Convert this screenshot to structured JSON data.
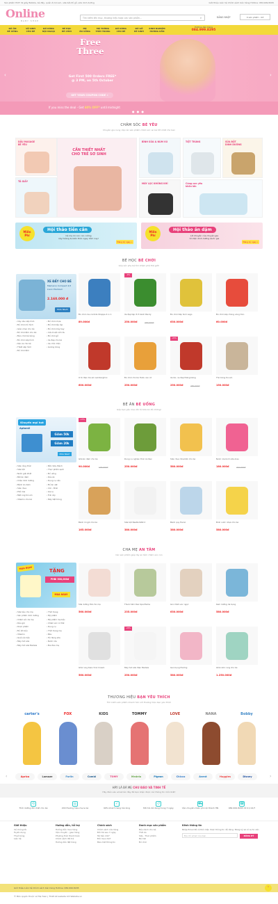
{
  "topbar": {
    "left": "Sản phẩm HOT: tã giấy Bobble, bé đẩy, quần ối,hơi em, sữa bột,đồ gỗ, sữa dinh dưỡng",
    "right": "Giới thiệu   Liên hệ   Chính sách bán hàng   Hotline: 084.999.8295"
  },
  "header": {
    "logo_main": "Online",
    "logo_sub": "BABY SHOP",
    "search_placeholder": "Tìm kiếm tên mục, thương hiệu hoặc các sản phẩm...",
    "account_link": "ĐĂNG NHẬP",
    "cart": "0 sản phẩm - 0đ"
  },
  "nav": {
    "items": [
      {
        "label": "ĐỒ ĂN\nBÉ UỐNG"
      },
      {
        "label": "VỆ SINH\nCHO BÉ"
      },
      {
        "label": "ĐỒ DÙNG\nNỘI NGOẠI"
      },
      {
        "label": "BÉ HỌC\nBÉ CHƠI"
      },
      {
        "label": "MẸ\nĂN UỐNG"
      },
      {
        "label": "MẸ TƯỜNG\nTHỜI TRANG"
      },
      {
        "label": "ĐỒ DÙNG\nCHO BÉ"
      },
      {
        "label": "ĐỒ GỖ\nBÉ SINH"
      },
      {
        "label": "KINH NGHIỆM\nHƯỚNG DẪN"
      }
    ],
    "hotline_label": "Hotline bán hàng",
    "hotline_number": "084.999.8295"
  },
  "banner": {
    "headline": "Free\nThree",
    "line1": "Get First 500 Orders FREE*",
    "line2": "@ 3 PM, on 5th October",
    "coupon_btn": "GET YOUR COUPON CODE »",
    "bottom_pre": "If you miss the deal - Get ",
    "bottom_highlight": "60% OFF*",
    "bottom_post": " until midnight",
    "prev": "‹",
    "next": "›",
    "dots": "● ● ●"
  },
  "sections": {
    "care": {
      "pre": "CHĂM SÓC ",
      "hl": "BÉ YÊU",
      "sub": "Chuyên gia cung cấp các sản phẩm chăm sóc an bé tốt nhất cho bạn"
    },
    "toys": {
      "pre": "BÉ HỌC ",
      "hl": "BÉ CHƠI",
      "sub": "Góp sức phụ bé tìm khám phá thế giới!"
    },
    "food": {
      "pre": "BÉ ĂN ",
      "hl": "BÉ UỐNG",
      "sub": "Góp bạn yêu mau lớn từ bữa ăn đó những!"
    },
    "mom": {
      "pre": "CHA MẸ ",
      "hl": "AN TÂM",
      "sub": "Các sản phẩm giúp lấy an tâm chăm sóc con"
    },
    "brands": {
      "pre": "THƯƠNG HIỆU ",
      "hl": "BẠN YÊU THÍCH",
      "sub": "Tìm kiếm sản phẩm nhanh hơn với thương hiệu bạn yêu thích"
    }
  },
  "care_tiles": [
    {
      "label": "DẦU MASAGE\nBÉ YÊU"
    },
    {
      "label": "CẦN THIẾT NHẤT\nCHO TRẺ SƠ SINH"
    },
    {
      "label": "BÌNH SỮA & NÚM VÚ"
    },
    {
      "label": "TIỆT TRÙNG"
    },
    {
      "label": "SỮA BỘT\nDINH DƯỠNG"
    },
    {
      "label": "TÃ GIẤY"
    },
    {
      "label": "MÁY LỌC KHÔNG KHÍ"
    },
    {
      "label": "Cùng con yêu\nkhôn lớn"
    }
  ],
  "wide_banners": [
    {
      "badge": "Miễn\nPhí",
      "title": "Hội thảo tiền cân",
      "desc": "Cả mẹ mi con con cường\nnày hoàng bị kiến thức ngay hôm nay!",
      "btn": "Đăng ký ngay »"
    },
    {
      "badge": "Miễn\nPhí",
      "title": "Hội thảo ăn dặm",
      "desc": "Lời khuyên của chuyên gia\ntừ Viện dinh dưỡng Quốc gia",
      "btn": "Đăng ký ngay »"
    }
  ],
  "toys_promo": {
    "title": "XE ĐẨY CHO BÉ",
    "sub": "Mamaroo Compact 2/3",
    "sub2": "Livon Premium",
    "price": "2.160.000 đ",
    "btn": "MUA NGAY"
  },
  "toys_links": [
    "Cây xâu xếp hình",
    "Đồ chơi mô hình",
    "Giàn nhạc cho bé",
    "Đồ chơi tắm cho bé",
    "Đèn chơi bé bóng",
    "Đồ chơi xếp hình",
    "Kéo xe cho bé",
    "Thiết xếp hình",
    "Đồ chơi tắm",
    "Đồ chơi nhựa",
    "Đồ chơi lắp ráp",
    "Đồ chơi máy bay",
    "Cầu trượt xích đu",
    "Đồ chơi gỗ",
    "Xe đạp cho bé",
    "Xe chòi chân",
    "Gương bóng"
  ],
  "toys_products": [
    {
      "name": "Đồ chơi câu cá Kids Shoppe 4 in 1",
      "price": "89.000đ",
      "old": "",
      "disc": ""
    },
    {
      "name": "Xe đạp tập đi 3 bánh Pandy",
      "price": "250.000đ",
      "old": "290.000đ",
      "disc": "-4%"
    },
    {
      "name": "Đồ chơi Xếp hình Lego",
      "price": "630.000đ",
      "old": "",
      "disc": ""
    },
    {
      "name": "Đồ chơi xếp chồng vòng tròn",
      "price": "60.000đ",
      "old": "",
      "disc": ""
    },
    {
      "name": "Ô tô điện trẻ em Lamborghini",
      "price": "600.000đ",
      "old": "",
      "disc": ""
    },
    {
      "name": "Đồ chơi cho bé Hươu cao cổ",
      "price": "250.000đ",
      "old": "",
      "disc": ""
    },
    {
      "name": "Xe lắc, xe đạp thăng bằng",
      "price": "250.000đ",
      "old": "280.000đ",
      "disc": "-21%"
    },
    {
      "name": "Thỏ bông trẻ em",
      "price": "150.000đ",
      "old": "",
      "disc": ""
    }
  ],
  "food_promo": {
    "title": "Khuyến mại hot",
    "brand": "Aptamil",
    "tag1": "Giảm 50k",
    "tag2": "Giảm 20k",
    "btn": "MUA NGAY"
  },
  "food_links": [
    "Sữa công thức",
    "Sữa bột",
    "Nước giải khát",
    "Bột ăn dặm",
    "Cháo dinh dưỡng",
    "Bánh ăn dặm",
    "Sữa chua",
    "Phô mai",
    "Mật ong trẻ em",
    "Vitamin cho bé",
    "Bột, Sữa, Bánh",
    "Thực phẩm sạch",
    "Đồ uống",
    "Dầu ăn",
    "Dụng cụ nấu",
    "Đồ ăn vặt",
    "Cốc - Bình",
    "Gia vị",
    "Trái cây",
    "Máy tiệt trùng"
  ],
  "food_products": [
    {
      "name": "Ghế ăn dặm cho bé",
      "price": "90.000đ",
      "old": "109.000đ",
      "disc": "-17%"
    },
    {
      "name": "Dung cụ nghiền thức ăn Rex",
      "price": "250.000đ",
      "old": "",
      "disc": ""
    },
    {
      "name": "Sữa chua Vinamilk cho bé",
      "price": "580.000đ",
      "old": "",
      "disc": ""
    },
    {
      "name": "Nước rửa bình sữa Arau",
      "price": "180.000đ",
      "old": "210.000đ",
      "disc": ""
    },
    {
      "name": "Bánh mì gối cho bé",
      "price": "165.000đ",
      "old": "",
      "disc": ""
    },
    {
      "name": "Sữa bột Nestlé NAN 2",
      "price": "380.000đ",
      "old": "",
      "disc": ""
    },
    {
      "name": "Bánh quy Heinz",
      "price": "380.000đ",
      "old": "",
      "disc": ""
    },
    {
      "name": "Bình nước nhựa cho bé",
      "price": "580.000đ",
      "old": "",
      "disc": ""
    }
  ],
  "mom_promo": {
    "title": "MUA NGAY",
    "tag": "TẶNG",
    "val": "PHBI 500,000đ",
    "btn": "MUA NGAY"
  },
  "mom_links": [
    "Sữa bầu cho mẹ",
    "Sản phẩm dinh dưỡng",
    "Chăm sóc da mẹ",
    "Dầu gội",
    "Dược phẩm",
    "Đồ lót bầu",
    "Vitamin",
    "Quần áo bầu",
    "Máy hút sữa",
    "Máy hút sữa Medela",
    "Thời trang",
    "Mỹ phẩm",
    "Mỹ phẩm mẹ bầu",
    "Chăm sóc cơ thể",
    "Dụng cụ",
    "Thời trang mẹ",
    "Bầu",
    "Túi đựng sữa",
    "Nước rửa",
    "Đai đeo mẹ"
  ],
  "mom_products": [
    {
      "name": "Sữa dưỡng thể cho mẹ",
      "price": "560.000đ",
      "old": "",
      "disc": ""
    },
    {
      "name": "Thuốc tắm Dao Spa Mama",
      "price": "235.000đ",
      "old": "",
      "disc": ""
    },
    {
      "name": "Gói chăm sóc ngực",
      "price": "630.000đ",
      "old": "",
      "disc": ""
    },
    {
      "name": "Kem dưỡng da bụng",
      "price": "580.000đ",
      "old": "",
      "disc": ""
    },
    {
      "name": "Ghế rung Kara 3in1 Cream",
      "price": "560.000đ",
      "old": "",
      "disc": ""
    },
    {
      "name": "Máy hút sữa điện Medela",
      "price": "250.000đ",
      "old": "",
      "disc": "-22%"
    },
    {
      "name": "Gen bụng thường",
      "price": "580.000đ",
      "old": "",
      "disc": ""
    },
    {
      "name": "Ghế nằm rung cho bé",
      "price": "1.250.000đ",
      "old": "",
      "disc": ""
    }
  ],
  "brands": [
    {
      "name": "carter's"
    },
    {
      "name": "FOX"
    },
    {
      "name": "KIDS"
    },
    {
      "name": "TOMMY"
    },
    {
      "name": "LOVE"
    },
    {
      "name": "NANA"
    },
    {
      "name": "Bobby"
    }
  ],
  "brand_logos": [
    "Aprica",
    "Lamaze",
    "Farlin",
    "Combi",
    "TOMY",
    "Medela",
    "Pigeon",
    "Chicco",
    "Avent",
    "Huggies",
    "Disney"
  ],
  "subscribe": {
    "title_pre": "HÃY LÀ BÀ MẸ ",
    "title_hl": "CHU ĐÁO VÀ TINH TẾ",
    "desc": "Hãy điền vào email lên đây để bạn nhận được các thông tin mới nhất!",
    "placeholder": "Nhập email của bạn...",
    "btn": "ĐĂNG KÝ"
  },
  "features": [
    {
      "icon": "⟲",
      "text": "Thời dưỡng đổi chất cho bé"
    },
    {
      "icon": "◎",
      "text": "200 thương hiệu mẹ & bé"
    },
    {
      "icon": "✓",
      "text": "99% khách hàng hài lòng"
    },
    {
      "icon": "↺",
      "text": "Đổi trả dễ dàng trong 7 ngày"
    },
    {
      "icon": "⛟",
      "text": "Vận chuyển miễn phí nội thành HN"
    },
    {
      "icon": "☎",
      "text": "084.999.8295 hỗ trợ 24/7"
    }
  ],
  "footer": {
    "cols": [
      {
        "h": "Giới thiệu",
        "items": [
          "Về chúng tôi",
          "Tuyển dụng",
          "Thuở bóng",
          "Liên hệ"
        ]
      },
      {
        "h": "Hướng dẫn, hỗ trợ",
        "items": [
          "Hướng dẫn mua hàng",
          "Vận chuyển - giao hàng",
          "Phương thức thanh toán",
          "Chính sách đổi trả",
          "Hướng dẫn đặt hàng"
        ]
      },
      {
        "h": "Chính sách",
        "items": [
          "Chính sách cửa hàng",
          "Đổi trả sau 7 ngày",
          "Tái tiền 24/7",
          "Đổi mua 24/7",
          "Bảo mật thông tin"
        ]
      },
      {
        "h": "Danh mục sản phẩm",
        "items": [
          "Bầu dành cho bé",
          "Thời áo",
          "Sữa - Thực phẩm",
          "Bé mãi",
          "Đồ chơi"
        ]
      }
    ],
    "news_title": "Kênh thông tin",
    "news_desc": "Nhập Email để cả thể nhận được thông tin dễ dàng. Đăng ký sẽ có sự tư vấn",
    "news_placeholder": "Địa chỉ email của bạn",
    "news_btn": "ĐĂNG KÝ"
  },
  "bottombar": {
    "left": "Giới thiệu   Liên hệ   Chính sách bán hàng   Hotline: 084.999.8295",
    "copy": "© Bản quyền thuộc về Mẹ Tuan | Thiết kế website bởi Website.vn"
  },
  "colors": {
    "accent": "#e8417b",
    "nav": "#f3d93a",
    "price": "#e22222",
    "banner": "#f7a9c3"
  }
}
